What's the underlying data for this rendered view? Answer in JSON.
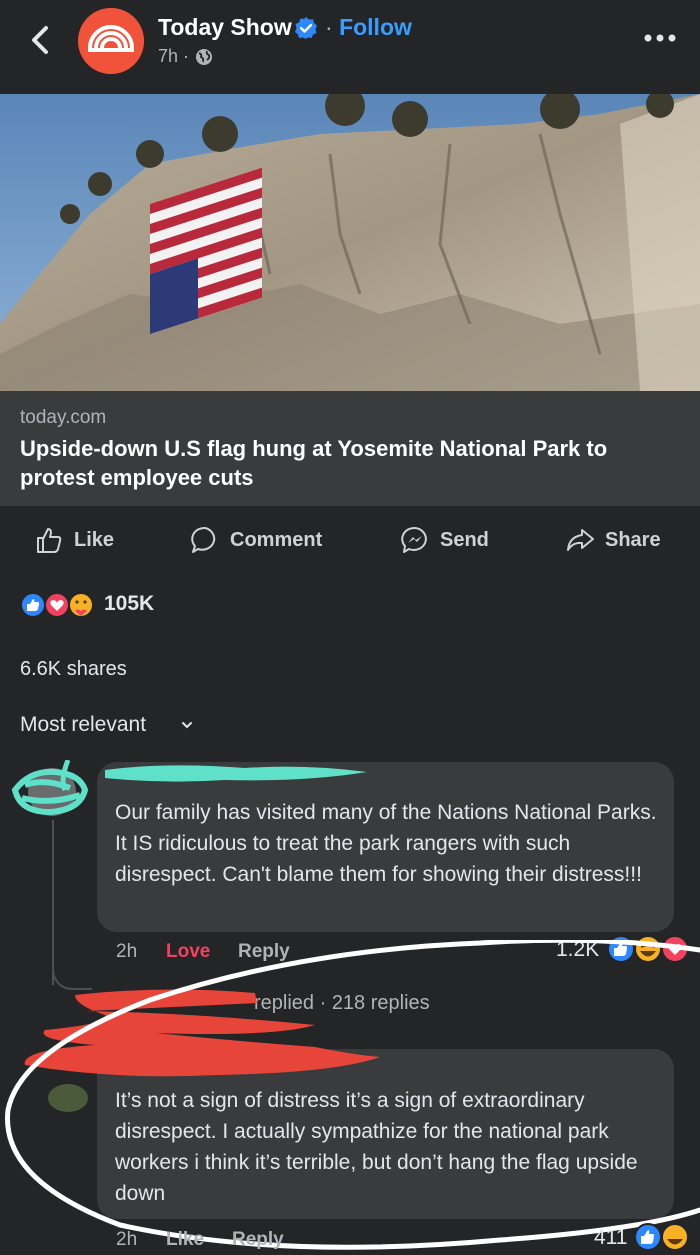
{
  "header": {
    "page_name": "Today Show",
    "follow_dot": "·",
    "follow_label": "Follow",
    "time": "7h ·"
  },
  "link_preview": {
    "domain": "today.com",
    "headline": "Upside-down U.S flag hung at Yosemite National Park to protest employee cuts"
  },
  "actions": {
    "like": "Like",
    "comment": "Comment",
    "send": "Send",
    "share": "Share"
  },
  "reactions": {
    "count": "105K",
    "shares": "6.6K shares"
  },
  "sort": {
    "label": "Most relevant"
  },
  "comments": [
    {
      "text": "Our family has visited many of the Nations National Parks.  It IS ridiculous to treat the park rangers with such disrespect.  Can't blame them for showing their distress!!!",
      "time": "2h",
      "reaction_label": "Love",
      "reply_label": "Reply",
      "reaction_count": "1.2K",
      "replied_text": "replied · 218 replies"
    },
    {
      "text": "It’s not a sign of distress it’s a sign of extraordinary disrespect.  I actually sympathize for the national park workers i think it’s terrible,  but don’t hang the flag upside down",
      "time": "2h",
      "reaction_label": "Like",
      "reply_label": "Reply",
      "reaction_count": "411"
    }
  ],
  "colors": {
    "background": "#242526",
    "bubble": "#3a3b3c",
    "accent_blue": "#3b9cff",
    "love_red": "#f3425f",
    "avatar_orange": "#f0533a",
    "scribble_teal": "#5ee0c9",
    "scribble_red": "#e8453a"
  }
}
